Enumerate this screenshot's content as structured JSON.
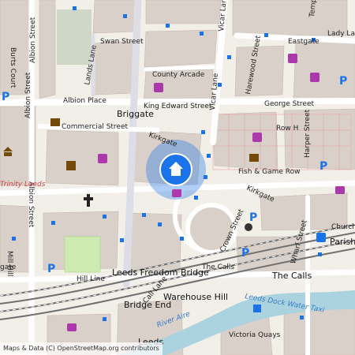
{
  "map": {
    "attribution": "Maps & Data (C) OpenStreetMap.org contributors",
    "labels": {
      "swan_street": "Swan Street",
      "county_arcade": "County Arcade",
      "albion_place": "Albion Place",
      "king_edward_street": "King Edward Street",
      "george_street": "George Street",
      "briggate": "Briggate",
      "commercial_street": "Commercial Street",
      "kirkgate": "Kirkgate",
      "kirkgate_2": "Kirkgate",
      "fish_game_row": "Fish & Game Row",
      "row_h": "Row H",
      "harper_street": "Harper Street",
      "harewood_street": "Harewood Street",
      "vicar_lane": "Vicar Lane",
      "vicar_lane_2": "Vicar Lane",
      "eastgate": "Eastgate",
      "lady_lane": "Lady La",
      "templar": "Templ",
      "lands_lane": "Lands Lane",
      "albion_street_1": "Albion Street",
      "albion_street_2": "Albion Street",
      "albion_street_3": "Albion Street",
      "burts_court": "Burts Court",
      "trinity_leeds": "Trinity Leeds",
      "mill_hill": "Mill Hill",
      "gate": "gate",
      "hill_line": "Hill Line",
      "leeds_freedom_bridge": "Leeds Freedom Bridge",
      "call_lane": "Call Lane",
      "bridge_end": "Bridge End",
      "warehouse_hill": "Warehouse Hill",
      "leeds_dock_water_taxi": "Leeds Dock Water Taxi",
      "river_aire": "River Aire",
      "the_calls": "The Calls",
      "the_calls_2": "The Calls",
      "crown_street": "Crown Street",
      "wharf_street": "Wharf Street",
      "parish_church": "Parish Church",
      "church": "Church",
      "victoria_quays": "Victoria Quays",
      "leeds_bottom": "Leeds"
    },
    "parking_symbol": "P",
    "colors": {
      "land": "#f2efe9",
      "building": "#d9d0c9",
      "road": "#ffffff",
      "pedestrian": "#dddde8",
      "water": "#aad3df",
      "park": "#cdebb0",
      "railway": "#707070",
      "location": "#1a73e8",
      "bus_stop": "#1a73e8",
      "shop": "#ac39ac",
      "poi_brown": "#734a08"
    }
  }
}
